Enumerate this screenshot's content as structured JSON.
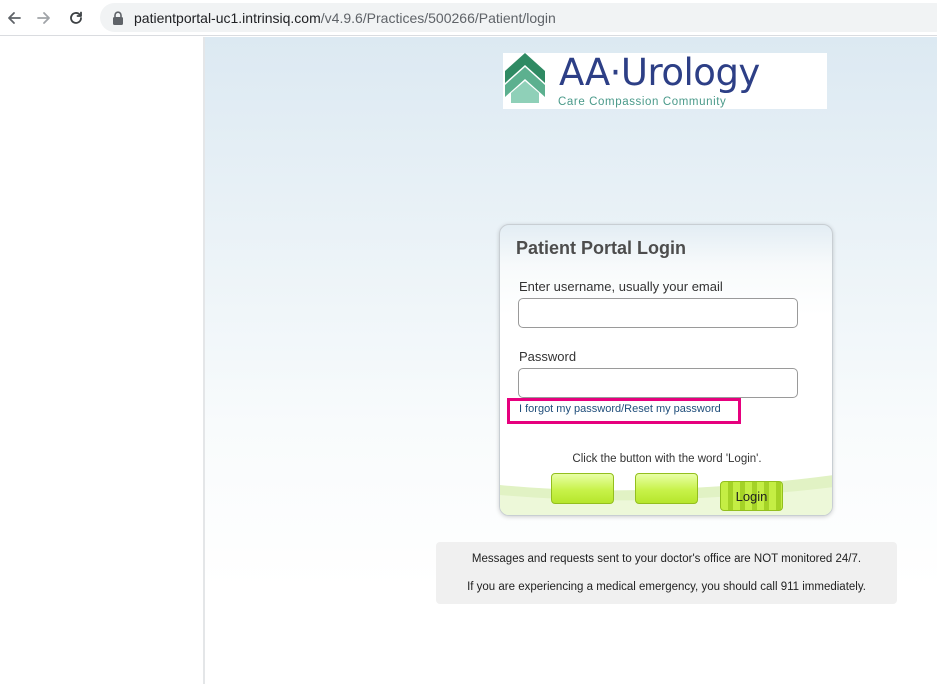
{
  "browser": {
    "url_host": "patientportal-uc1.intrinsiq.com",
    "url_path": "/v4.9.6/Practices/500266/Patient/login",
    "icons": {
      "back": "arrow-left-icon",
      "forward": "arrow-right-icon",
      "reload": "reload-icon",
      "secure": "lock-icon"
    }
  },
  "logo": {
    "name": "AA·Urology",
    "tagline": "Care Compassion Community",
    "colors": {
      "text": "#2d3f86",
      "tagline": "#4a9a8a",
      "mark_dark": "#2f8a63",
      "mark_light": "#8fd0b8"
    }
  },
  "login": {
    "title": "Patient Portal Login",
    "username_label": "Enter username, usually your email",
    "username_value": "",
    "password_label": "Password",
    "password_value": "",
    "forgot_link": "I forgot my password/Reset my password",
    "hint": "Click the button with the word 'Login'.",
    "buttons": [
      "",
      "",
      "Login"
    ],
    "highlight_color": "#e6007e"
  },
  "notice": {
    "line1": "Messages and requests sent to your doctor's office are NOT monitored 24/7.",
    "line2": "If you are experiencing a medical emergency, you should call 911 immediately."
  }
}
